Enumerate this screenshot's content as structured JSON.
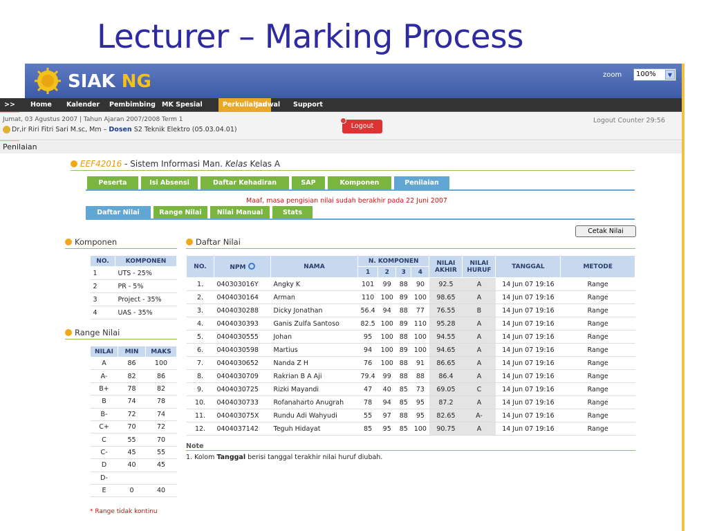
{
  "slide": {
    "title": "Lecturer – Marking Process"
  },
  "app": {
    "logo_main": "SIAK",
    "logo_accent": "NG",
    "zoom_label": "zoom",
    "zoom_value": "100%"
  },
  "nav": {
    "prefix": ">>",
    "items": [
      "Home",
      "Kalender",
      "Pembimbing",
      "MK Spesial",
      "Perkuliahan",
      "Jadwal",
      "Support"
    ],
    "active": "Perkuliahan"
  },
  "info": {
    "date_line": "Jumat, 03 Agustus 2007 | Tahun Ajaran 2007/2008 Term 1",
    "user_name": "Dr,ir Riri Fitri Sari M.sc, Mm",
    "user_sep": " – ",
    "user_role": "Dosen",
    "user_unit": "S2 Teknik Elektro (05.03.04.01)",
    "logout_label": "Logout",
    "counter": "Logout Counter 29:56"
  },
  "page_title": "Penilaian",
  "course": {
    "code": "EEF42016",
    "sep": " - ",
    "name": "Sistem Informasi Man.",
    "kelas_label": "Kelas",
    "kelas_value": "Kelas A"
  },
  "tabs_main": [
    "Peserta",
    "Isi Absensi",
    "Daftar Kehadiran",
    "SAP",
    "Komponen",
    "Penilaian"
  ],
  "notice": "Maaf, masa pengisian nilai sudah berakhir pada 22 Juni 2007",
  "tabs_sub": [
    "Daftar Nilai",
    "Range Nilai",
    "Nilai Manual",
    "Stats"
  ],
  "cetak_label": "Cetak Nilai",
  "komponen": {
    "title": "Komponen",
    "headers": [
      "NO.",
      "KOMPONEN"
    ],
    "rows": [
      [
        "1",
        "UTS - 25%"
      ],
      [
        "2",
        "PR - 5%"
      ],
      [
        "3",
        "Project - 35%"
      ],
      [
        "4",
        "UAS - 35%"
      ]
    ]
  },
  "range": {
    "title": "Range Nilai",
    "headers": [
      "NILAI",
      "MIN",
      "MAKS"
    ],
    "rows": [
      [
        "A",
        "86",
        "100"
      ],
      [
        "A-",
        "82",
        "86"
      ],
      [
        "B+",
        "78",
        "82"
      ],
      [
        "B",
        "74",
        "78"
      ],
      [
        "B-",
        "72",
        "74"
      ],
      [
        "C+",
        "70",
        "72"
      ],
      [
        "C",
        "55",
        "70"
      ],
      [
        "C-",
        "45",
        "55"
      ],
      [
        "D",
        "40",
        "45"
      ],
      [
        "D-",
        "",
        ""
      ],
      [
        "E",
        "0",
        "40"
      ]
    ],
    "footnote": "* Range tidak kontinu"
  },
  "nilai": {
    "title": "Daftar Nilai",
    "headers": {
      "no": "NO.",
      "npm": "NPM",
      "nama": "NAMA",
      "komp": "N. KOMPONEN",
      "komp_sub": [
        "1",
        "2",
        "3",
        "4"
      ],
      "akhir": "NILAI AKHIR",
      "huruf": "NILAI HURUF",
      "tanggal": "TANGGAL",
      "metode": "METODE"
    },
    "rows": [
      [
        "1.",
        "040303016Y",
        "Angky K",
        "101",
        "99",
        "88",
        "90",
        "92.5",
        "A",
        "14 Jun 07 19:16",
        "Range"
      ],
      [
        "2.",
        "0404030164",
        "Arman",
        "110",
        "100",
        "89",
        "100",
        "98.65",
        "A",
        "14 Jun 07 19:16",
        "Range"
      ],
      [
        "3.",
        "0404030288",
        "Dicky Jonathan",
        "56.4",
        "94",
        "88",
        "77",
        "76.55",
        "B",
        "14 Jun 07 19:16",
        "Range"
      ],
      [
        "4.",
        "0404030393",
        "Ganis Zulfa Santoso",
        "82.5",
        "100",
        "89",
        "110",
        "95.28",
        "A",
        "14 Jun 07 19:16",
        "Range"
      ],
      [
        "5.",
        "0404030555",
        "Johan",
        "95",
        "100",
        "88",
        "100",
        "94.55",
        "A",
        "14 Jun 07 19:16",
        "Range"
      ],
      [
        "6.",
        "0404030598",
        "Martius",
        "94",
        "100",
        "89",
        "100",
        "94.65",
        "A",
        "14 Jun 07 19:16",
        "Range"
      ],
      [
        "7.",
        "0404030652",
        "Nanda Z H",
        "76",
        "100",
        "88",
        "91",
        "86.65",
        "A",
        "14 Jun 07 19:16",
        "Range"
      ],
      [
        "8.",
        "0404030709",
        "Rakrian B A Aji",
        "79.4",
        "99",
        "88",
        "88",
        "86.4",
        "A",
        "14 Jun 07 19:16",
        "Range"
      ],
      [
        "9.",
        "0404030725",
        "Rizki Mayandi",
        "47",
        "40",
        "85",
        "73",
        "69.05",
        "C",
        "14 Jun 07 19:16",
        "Range"
      ],
      [
        "10.",
        "0404030733",
        "Rofanaharto Anugrah",
        "78",
        "94",
        "85",
        "95",
        "87.2",
        "A",
        "14 Jun 07 19:16",
        "Range"
      ],
      [
        "11.",
        "040403075X",
        "Rundu Adi Wahyudi",
        "55",
        "97",
        "88",
        "95",
        "82.65",
        "A-",
        "14 Jun 07 19:16",
        "Range"
      ],
      [
        "12.",
        "0404037142",
        "Teguh Hidayat",
        "85",
        "95",
        "85",
        "100",
        "90.75",
        "A",
        "14 Jun 07 19:16",
        "Range"
      ]
    ]
  },
  "note": {
    "title": "Note",
    "prefix": "1. Kolom ",
    "bold": "Tanggal",
    "suffix": " berisi tanggal terakhir nilai huruf diubah."
  },
  "colors": {
    "title": "#2e2aa0",
    "header_blue": "#3d5aa6",
    "tab_green": "#7ab53f",
    "tab_blue": "#62a6d3",
    "accent_orange": "#e8a92a",
    "notice_red": "#cc1111"
  }
}
